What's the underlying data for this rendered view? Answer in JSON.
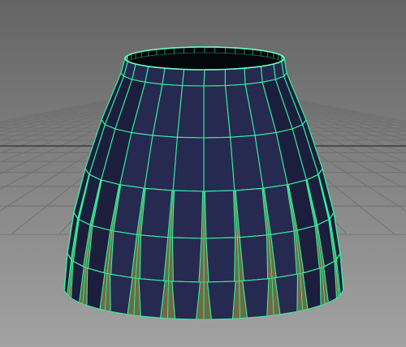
{
  "viewport": {
    "background_top": "#646464",
    "background_bottom": "#a2a2a2",
    "grid_color": "#707070",
    "grid_axis_color": "#3a3a3a"
  },
  "mesh": {
    "name": "pleated-skirt-mesh",
    "state": "selected",
    "face_color": "#262a50",
    "face_dark": "#1b1e3c",
    "inner_color": "#03060a",
    "gap_color": "#6c6c44",
    "wire_color": "#36f0a0",
    "wire_bright": "#6cffc8"
  }
}
